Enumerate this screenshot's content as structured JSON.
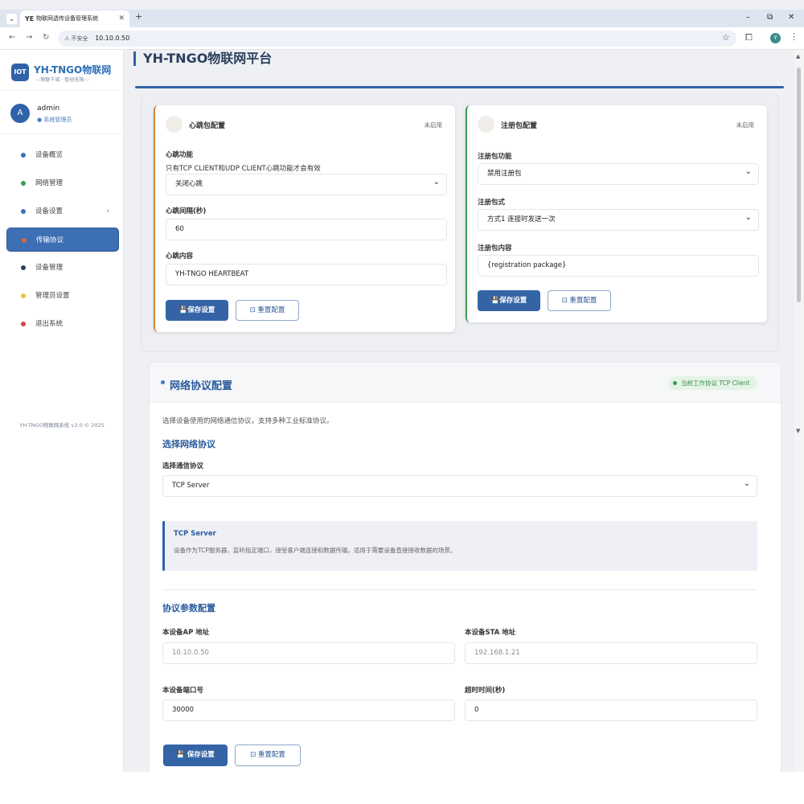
{
  "browser": {
    "tab_title": "物联网透传设备管理系统",
    "tab_favicon": "YE",
    "url_warning": "不安全",
    "url": "10.10.0.50",
    "profile_initial": "Y"
  },
  "brand": {
    "logo_badge": "IOT",
    "name": "YH-TNGO物联网",
    "slogan": "---物联千城 · 智创无限---"
  },
  "user": {
    "initial": "A",
    "name": "admin",
    "role": "● 系统管理员"
  },
  "sidebar": {
    "items": [
      {
        "label": "设备概览",
        "color": "#3d6fb5"
      },
      {
        "label": "网络管理",
        "color": "#3d9a55"
      },
      {
        "label": "设备设置",
        "color": "#3d6fb5",
        "chevron": "›"
      },
      {
        "label": "传输协议",
        "color": "#e0663c",
        "active": true
      },
      {
        "label": "设备管理",
        "color": "#2b3f5c"
      },
      {
        "label": "管理员设置",
        "color": "#e6c23c"
      },
      {
        "label": "退出系统",
        "color": "#d64545"
      }
    ],
    "footer": "YH-TNGO物联网系统 v3.0 © 2025"
  },
  "page": {
    "title": "YH-TNGO物联网平台"
  },
  "heartbeat": {
    "title": "心跳包配置",
    "state": "未启用",
    "function_label": "心跳功能",
    "hint": "只有TCP CLIENT和UDP CLIENT心跳功能才会有效",
    "function_value": "关闭心跳",
    "interval_label": "心跳间隔(秒)",
    "interval_value": "60",
    "content_label": "心跳内容",
    "content_value": "YH-TNGO HEARTBEAT",
    "save_label": "💾保存设置",
    "reset_label": "⊡ 重置配置"
  },
  "registration": {
    "title": "注册包配置",
    "state": "未启用",
    "function_label": "注册包功能",
    "function_value": "禁用注册包",
    "mode_label": "注册包式",
    "mode_value": "方式1 连接时发送一次",
    "content_label": "注册包内容",
    "content_value": "{registration package}",
    "save_label": "💾保存设置",
    "reset_label": "⊡ 重置配置"
  },
  "protocol": {
    "title": "网络协议配置",
    "badge": "当前工作协议  TCP Client",
    "description": "选择设备使用的网络通信协议，支持多种工业标准协议。",
    "select_section": "选择网络协议",
    "select_label": "选择通信协议",
    "select_value": "TCP Server",
    "info_title": "TCP Server",
    "info_text": "设备作为TCP服务器，监听指定端口，接受客户端连接和数据传输。适用于需要设备直接接收数据的场景。",
    "params_section": "协议参数配置",
    "ap_label": "本设备AP 地址",
    "ap_value": "10.10.0.50",
    "sta_label": "本设备STA 地址",
    "sta_value": "192.168.1.21",
    "port_label": "本设备端口号",
    "port_value": "30000",
    "timeout_label": "超时时间(秒)",
    "timeout_value": "0",
    "save_label": "💾  保存设置",
    "reset_label": "⊡  重置配置"
  }
}
